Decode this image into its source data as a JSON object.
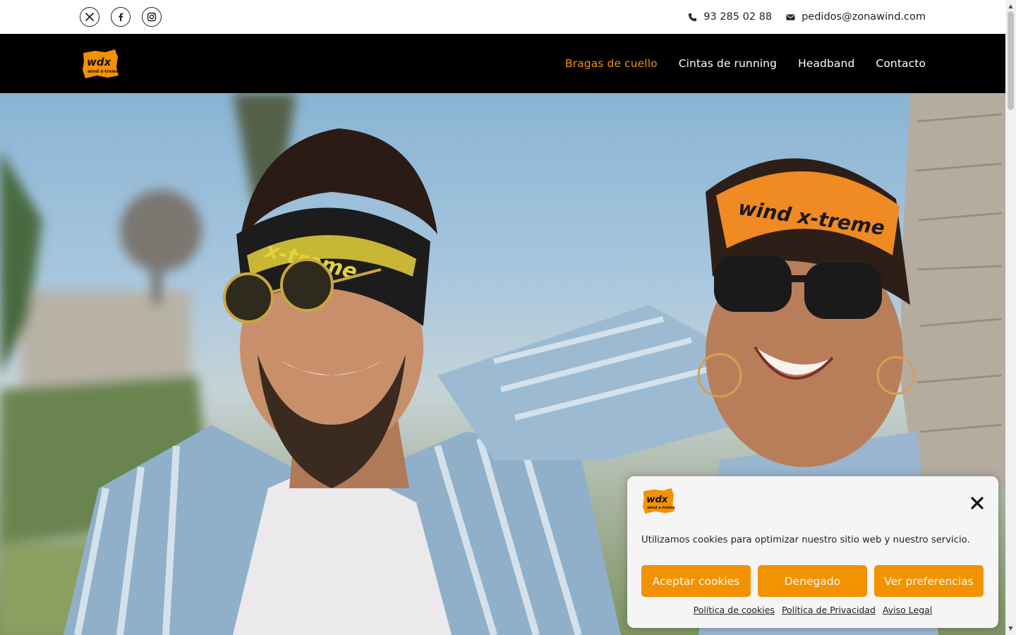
{
  "topbar": {
    "social": [
      {
        "icon": "x-twitter-icon",
        "label": "X"
      },
      {
        "icon": "facebook-icon",
        "label": "f"
      },
      {
        "icon": "instagram-icon",
        "label": "instagram"
      }
    ],
    "phone": "93 285 02 88",
    "email": "pedidos@zonawind.com"
  },
  "header": {
    "logo_text": "wdx",
    "logo_subtext": "wind x-treme",
    "nav": [
      {
        "label": "Bragas de cuello",
        "active": true
      },
      {
        "label": "Cintas de running",
        "active": false
      },
      {
        "label": "Headband",
        "active": false
      },
      {
        "label": "Contacto",
        "active": false
      }
    ]
  },
  "hero": {
    "headband_left_text": "x-treme",
    "headband_right_text": "wind x-treme"
  },
  "cookie": {
    "message": "Utilizamos cookies para optimizar nuestro sitio web y nuestro servicio.",
    "accept": "Aceptar cookies",
    "deny": "Denegado",
    "preferences": "Ver preferencias",
    "links": [
      "Política de cookies",
      "Política de Privacidad",
      "Aviso Legal"
    ]
  },
  "colors": {
    "accent": "#f39200",
    "header_bg": "#000000",
    "banner_bg": "#f5f5f5"
  }
}
